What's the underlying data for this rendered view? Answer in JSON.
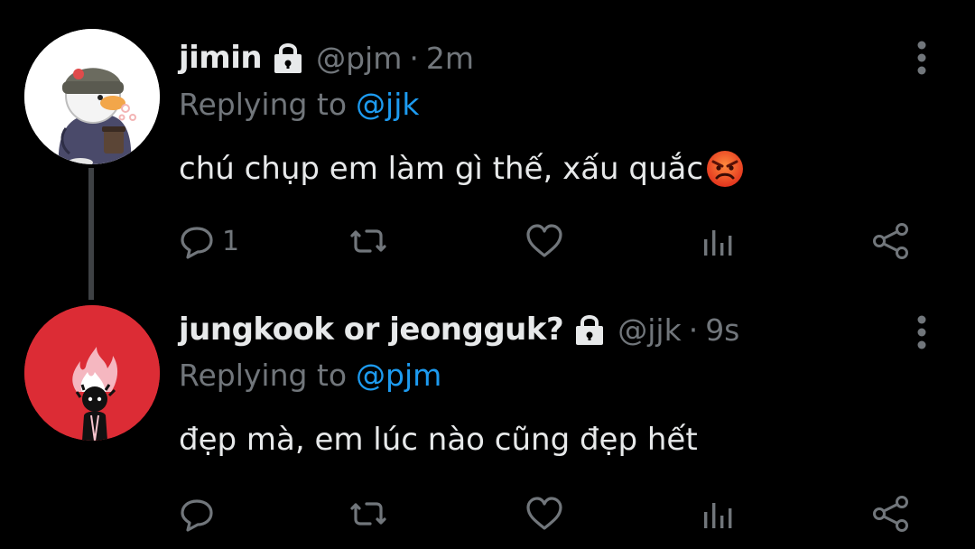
{
  "tweets": [
    {
      "name": "jimin",
      "handle": "@pjm",
      "separator": "·",
      "time": "2m",
      "replying_prefix": "Replying to",
      "replying_to": "@jjk",
      "text": "chú chụp em làm gì thế, xấu quắc",
      "emoji": "angry-face",
      "reply_count": "1",
      "avatar": "duck-with-beanie-illustration",
      "protected": true
    },
    {
      "name": "jungkook or jeongguk?",
      "handle": "@jjk",
      "separator": "·",
      "time": "9s",
      "replying_prefix": "Replying to",
      "replying_to": "@pjm",
      "text": "đẹp mà, em lúc nào cũng đẹp hết",
      "reply_count": "",
      "avatar": "figure-with-flames-illustration",
      "protected": true
    }
  ],
  "colors": {
    "background": "#000000",
    "text": "#e7e9ea",
    "secondary": "#71767b",
    "link": "#1d9bf0",
    "thread_line": "#3e4144",
    "avatar2_bg": "#dc2c35"
  },
  "icons": {
    "lock": "lock-icon",
    "more": "more-vertical-icon",
    "reply": "reply-icon",
    "retweet": "retweet-icon",
    "like": "heart-icon",
    "views": "views-icon",
    "share": "share-icon"
  }
}
